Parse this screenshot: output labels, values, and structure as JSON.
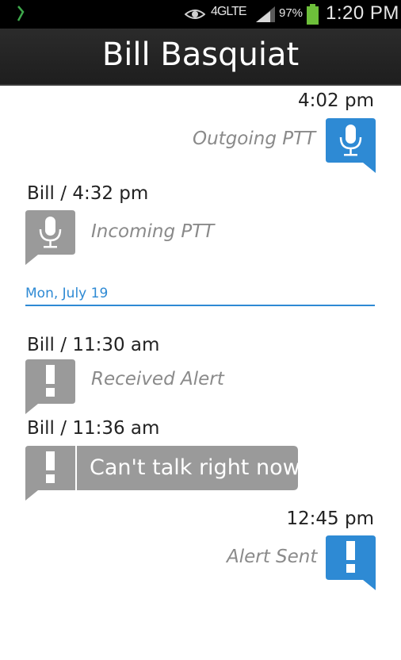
{
  "status_bar": {
    "network": "4GLTE",
    "battery_percent": "97%",
    "time": "1:20 PM",
    "icons": [
      "app-notification-icon",
      "eye-icon",
      "signal-icon",
      "battery-icon"
    ]
  },
  "header": {
    "title": "Bill Basquiat"
  },
  "messages": [
    {
      "timestamp": "4:02 pm",
      "label": "Outgoing PTT",
      "icon": "microphone-icon",
      "color": "#2e8ad4"
    },
    {
      "timestamp": "Bill / 4:32 pm",
      "label": "Incoming PTT",
      "icon": "microphone-icon",
      "color": "#9a9a9a"
    },
    {
      "timestamp": "Bill /  11:30 am",
      "label": "Received Alert",
      "icon": "alert-icon",
      "color": "#9a9a9a"
    },
    {
      "timestamp": "Bill / 11:36 am",
      "text": "Can't talk right now.",
      "icon": "alert-icon",
      "color": "#9a9a9a"
    },
    {
      "timestamp": "12:45 pm",
      "label": "Alert Sent",
      "icon": "alert-icon",
      "color": "#2e8ad4"
    }
  ],
  "date_divider": "Mon, July 19",
  "colors": {
    "accent": "#2e8ad4",
    "incoming": "#9a9a9a"
  }
}
